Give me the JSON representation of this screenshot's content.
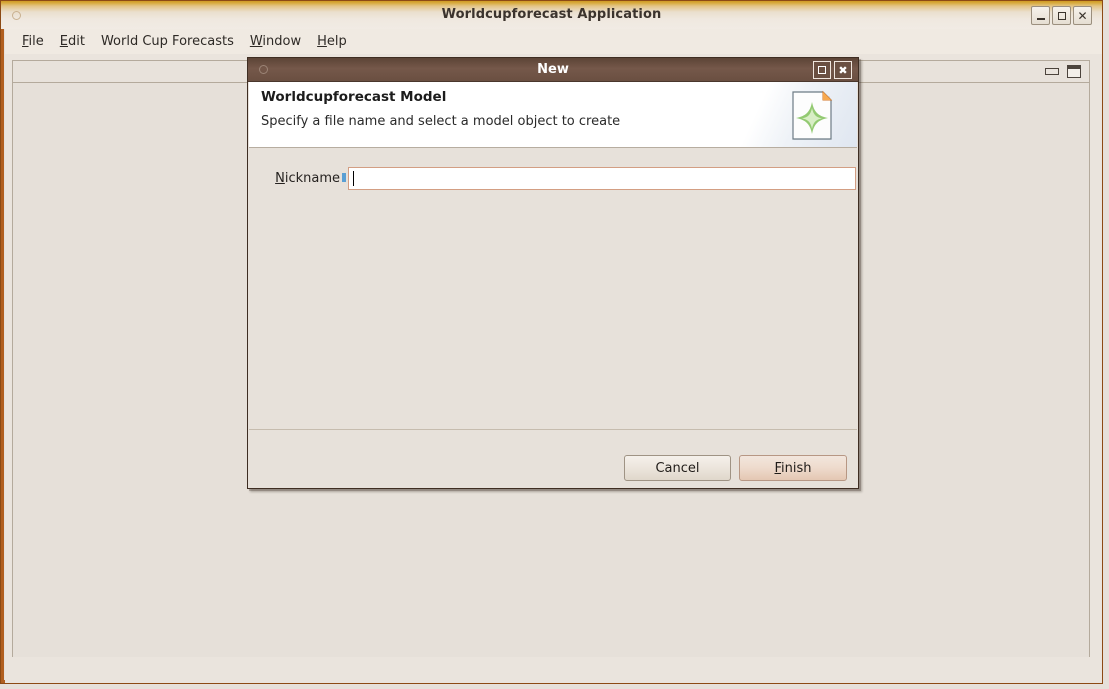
{
  "app_window": {
    "title": "Worldcupforecast Application",
    "controls": {
      "minimize": "minimize-icon",
      "maximize": "maximize-icon",
      "close": "close-icon"
    },
    "menubar": [
      {
        "label": "File",
        "mnemonic": "F"
      },
      {
        "label": "Edit",
        "mnemonic": "E"
      },
      {
        "label": "World Cup Forecasts",
        "mnemonic": ""
      },
      {
        "label": "Window",
        "mnemonic": "W"
      },
      {
        "label": "Help",
        "mnemonic": "H"
      }
    ],
    "inner_panel": {
      "minimize_icon": "minimize-icon",
      "restore_icon": "restore-icon"
    }
  },
  "dialog": {
    "title": "New",
    "controls": {
      "maximize": "maximize-icon",
      "close": "close-icon"
    },
    "header": {
      "heading": "Worldcupforecast Model",
      "subheading": "Specify a file name and select a model object to create",
      "icon": "new-model-document-icon"
    },
    "form": {
      "nickname": {
        "label_prefix": "N",
        "label_rest": "ickname",
        "value": "",
        "placeholder": ""
      }
    },
    "buttons": {
      "cancel": "Cancel",
      "finish_prefix": "F",
      "finish_rest": "inish"
    }
  },
  "colors": {
    "window_frame": "#b15f1f",
    "titlebar_accent": "#cf9a23",
    "dialog_titlebar": "#6a4f41",
    "input_border": "#d39e83",
    "default_button": "#e4c7b3",
    "panel_background": "#e6e0d9"
  }
}
